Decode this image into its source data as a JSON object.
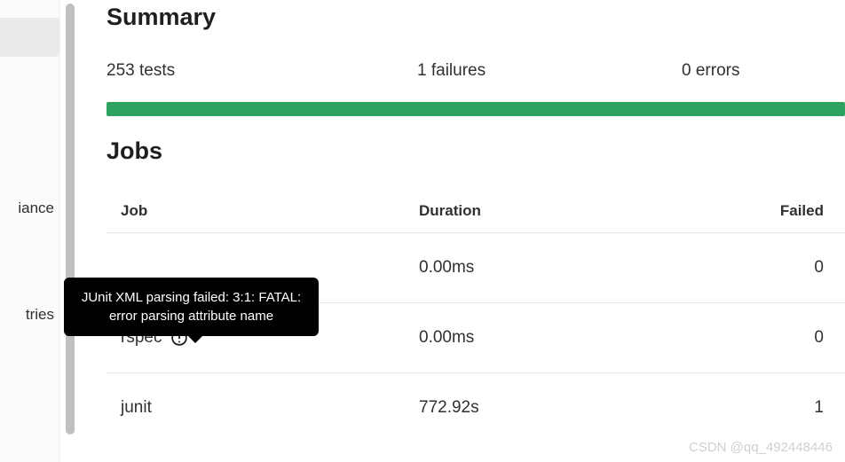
{
  "sidebar": {
    "items": [
      "iance",
      "tries"
    ]
  },
  "summary": {
    "title": "Summary",
    "tests": "253 tests",
    "failures": "1 failures",
    "errors": "0 errors"
  },
  "jobs": {
    "title": "Jobs",
    "headers": {
      "job": "Job",
      "duration": "Duration",
      "failed": "Failed"
    },
    "rows": [
      {
        "name": "",
        "duration": "0.00ms",
        "failed": "0",
        "warn": false
      },
      {
        "name": "rspec",
        "duration": "0.00ms",
        "failed": "0",
        "warn": true
      },
      {
        "name": "junit",
        "duration": "772.92s",
        "failed": "1",
        "warn": false
      }
    ]
  },
  "tooltip": {
    "text": "JUnit XML parsing failed: 3:1: FATAL: error parsing attribute name"
  },
  "watermark": "CSDN @qq_492448446"
}
